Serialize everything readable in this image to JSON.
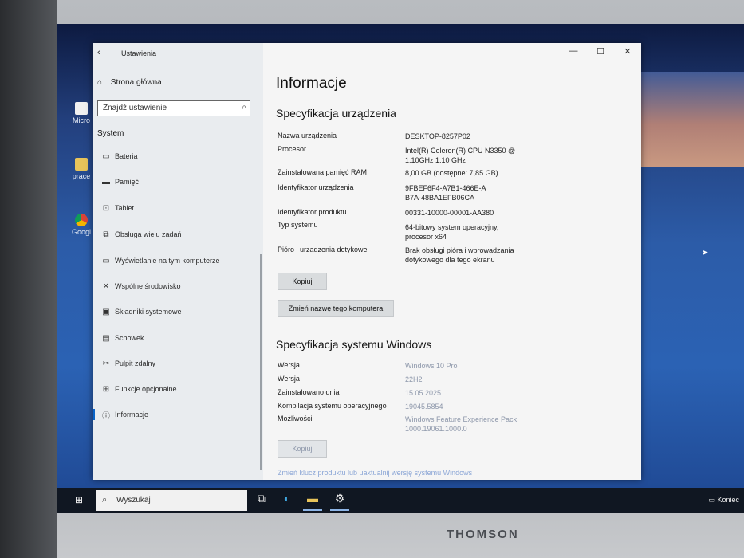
{
  "window": {
    "app_title": "Ustawienia",
    "back_glyph": "‹",
    "controls": [
      "—",
      "☐",
      "✕"
    ]
  },
  "sidebar": {
    "home_label": "Strona główna",
    "search_placeholder": "Znajdź ustawienie",
    "section": "System",
    "items": [
      {
        "label": "Bateria",
        "icon": "battery-icon",
        "glyph": "▭"
      },
      {
        "label": "Pamięć",
        "icon": "storage-icon",
        "glyph": "▬"
      },
      {
        "label": "Tablet",
        "icon": "tablet-icon",
        "glyph": "⊡"
      },
      {
        "label": "Obsługa wielu zadań",
        "icon": "multitasking-icon",
        "glyph": "⧉"
      },
      {
        "label": "Wyświetlanie na tym komputerze",
        "icon": "projecting-icon",
        "glyph": "▭"
      },
      {
        "label": "Wspólne środowisko",
        "icon": "shared-experiences-icon",
        "glyph": "✕"
      },
      {
        "label": "Składniki systemowe",
        "icon": "system-components-icon",
        "glyph": "▣"
      },
      {
        "label": "Schowek",
        "icon": "clipboard-icon",
        "glyph": "▤"
      },
      {
        "label": "Pulpit zdalny",
        "icon": "remote-desktop-icon",
        "glyph": "✂"
      },
      {
        "label": "Funkcje opcjonalne",
        "icon": "optional-features-icon",
        "glyph": "⊞"
      },
      {
        "label": "Informacje",
        "icon": "info-icon",
        "glyph": "ⓘ"
      }
    ]
  },
  "content": {
    "title": "Informacje",
    "device_spec_heading": "Specyfikacja urządzenia",
    "device_spec": [
      {
        "label": "Nazwa urządzenia",
        "value": "DESKTOP-8257P02"
      },
      {
        "label": "Procesor",
        "value": "Intel(R) Celeron(R) CPU N3350 @ 1.10GHz   1.10 GHz"
      },
      {
        "label": "Zainstalowana pamięć RAM",
        "value": "8,00 GB (dostępne: 7,85 GB)"
      },
      {
        "label": "Identyfikator urządzenia",
        "value": "9FBEF6F4-A7B1-466E-AB7A-48BA1EFB06CA"
      },
      {
        "label": "Identyfikator produktu",
        "value": "00331-10000-00001-AA380"
      },
      {
        "label": "Typ systemu",
        "value": "64-bitowy system operacyjny, procesor x64"
      },
      {
        "label": "Pióro i urządzenia dotykowe",
        "value": "Brak obsługi pióra i wprowadzania dotykowego dla tego ekranu"
      }
    ],
    "copy_button": "Kopiuj",
    "rename_button": "Zmień nazwę tego komputera",
    "windows_spec_heading": "Specyfikacja systemu Windows",
    "windows_spec": [
      {
        "label": "Wersja",
        "value": "Windows 10 Pro"
      },
      {
        "label": "Wersja",
        "value": "22H2"
      },
      {
        "label": "Zainstalowano dnia",
        "value": "15.05.2025"
      },
      {
        "label": "Kompilacja systemu operacyjnego",
        "value": "19045.5854"
      },
      {
        "label": "Możliwości",
        "value": "Windows Feature Experience Pack 1000.19061.1000.0"
      }
    ],
    "copy_button_2": "Kopiuj",
    "link_text": "Zmień klucz produktu lub uaktualnij wersję systemu Windows"
  },
  "taskbar": {
    "search_placeholder": "Wyszukaj",
    "icons": [
      "task-view-icon",
      "edge-icon",
      "file-explorer-icon",
      "settings-icon"
    ],
    "tray_text": "Koniec"
  },
  "desktop": {
    "icons": [
      {
        "label": "Micro",
        "icon": "microsoft-icon"
      },
      {
        "label": "prace",
        "icon": "folder-icon"
      },
      {
        "label": "Googl",
        "icon": "chrome-icon"
      }
    ]
  },
  "laptop": {
    "brand": "THOMSON"
  },
  "colors": {
    "accent": "#0a64c8",
    "taskbar": "#101722",
    "sidebar_bg": "#e9ecef"
  }
}
